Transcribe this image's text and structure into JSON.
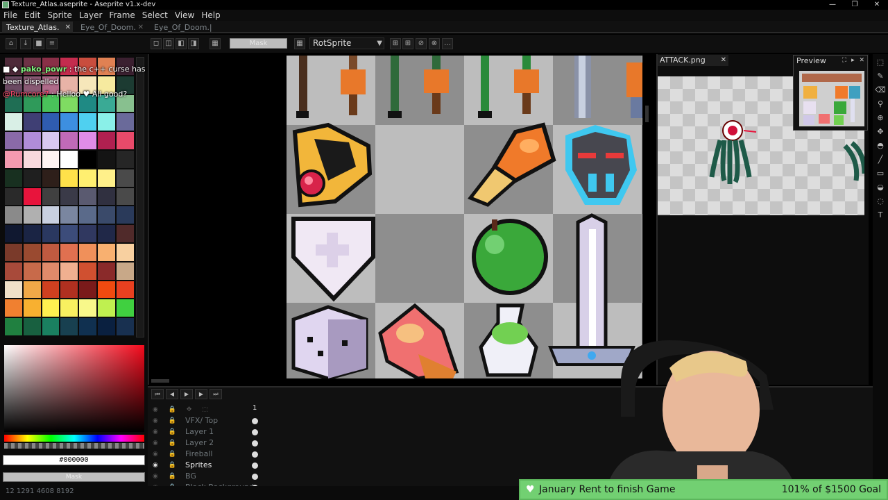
{
  "window": {
    "title": "Texture_Atlas.aseprite - Aseprite v1.x-dev",
    "controls": [
      "—",
      "❐",
      "✕"
    ]
  },
  "menu": [
    "File",
    "Edit",
    "Sprite",
    "Layer",
    "Frame",
    "Select",
    "View",
    "Help"
  ],
  "tabs": [
    "Texture_Atlas.",
    "Eye_Of_Doom.",
    "Eye_Of_Doom.|"
  ],
  "toolbar": {
    "mask_label": "Mask",
    "rotation_algorithm": "RotSprite"
  },
  "chat": [
    {
      "user": "pako_powr",
      "text": ": the c++ curse has been dispelled"
    },
    {
      "user": "@Rumcore7",
      "text": ": Helloo ♥ All good?"
    }
  ],
  "palette": [
    "#4e2a39",
    "#6e3246",
    "#8a2f47",
    "#c42c4e",
    "#c94d3e",
    "#e08153",
    "#3b2030",
    "#6b4a62",
    "#8a5a74",
    "#b06b8a",
    "#e8b3a7",
    "#f6e7ba",
    "#f6ea9f",
    "#1c3b32",
    "#1f6e54",
    "#2f9a5a",
    "#49c25a",
    "#7fdc62",
    "#1f8a84",
    "#3aaa95",
    "#88c08f",
    "#d9efe6",
    "#3f3f74",
    "#2f5cb0",
    "#3d8fe0",
    "#4fd0f0",
    "#8af0e8",
    "#6a6a9a",
    "#8a6aa8",
    "#b08cd8",
    "#d8c8f0",
    "#c06ab8",
    "#e08ce8",
    "#b02050",
    "#e84a6a",
    "#f49ab0",
    "#f8d8dc",
    "#fff4f2",
    "#ffffff",
    "#000000",
    "#141414",
    "#262626",
    "#183020",
    "#1f1f1f",
    "#2e1f1a",
    "#ffe14a",
    "#ffef70",
    "#fff08a",
    "#4a4a4a",
    "#2a2a2a",
    "#e8143c",
    "#404040",
    "#3a3a48",
    "#5a5a70",
    "#303040",
    "#4a4a4a",
    "#8a8a8a",
    "#b0b0b0",
    "#c8d0e0",
    "#7a86a0",
    "#5a6a8a",
    "#3a4a6a",
    "#2a3a5a",
    "#101830",
    "#1a2444",
    "#2a3860",
    "#3c4c7a",
    "#303860",
    "#202848",
    "#502a2a",
    "#7a3a2a",
    "#9a4a30",
    "#c05a40",
    "#e07050",
    "#f0905a",
    "#f8b070",
    "#f8d0a0",
    "#a84a3a",
    "#c86a4a",
    "#e08a6a",
    "#f0b090",
    "#d05030",
    "#8a2a2a",
    "#c8a888",
    "#f0e0c8",
    "#f0a848",
    "#d04020",
    "#b03020",
    "#7a1a1a",
    "#f04a10",
    "#e84020",
    "#f08030",
    "#f8b030",
    "#fff050",
    "#f8f060",
    "#f8f88a",
    "#bff050",
    "#40d040",
    "#208040",
    "#186040",
    "#1a8060",
    "#184050",
    "#103050",
    "#0a2040",
    "#183050"
  ],
  "colorbar": {
    "hex": "#000000",
    "alpha_label": "Mask"
  },
  "timeline": {
    "frame": "1",
    "layers": [
      "VFX/ Top",
      "Layer 1",
      "Layer 2",
      "Fireball",
      "Sprites",
      "BG",
      "Black Background"
    ],
    "active_layer": "Sprites"
  },
  "atlas_tab": "ATTACK.png",
  "preview": {
    "title": "Preview"
  },
  "status": "12 1291     4608 8192",
  "goal": {
    "name": "January Rent to finish Game",
    "progress": "101% of $1500 Goal"
  }
}
